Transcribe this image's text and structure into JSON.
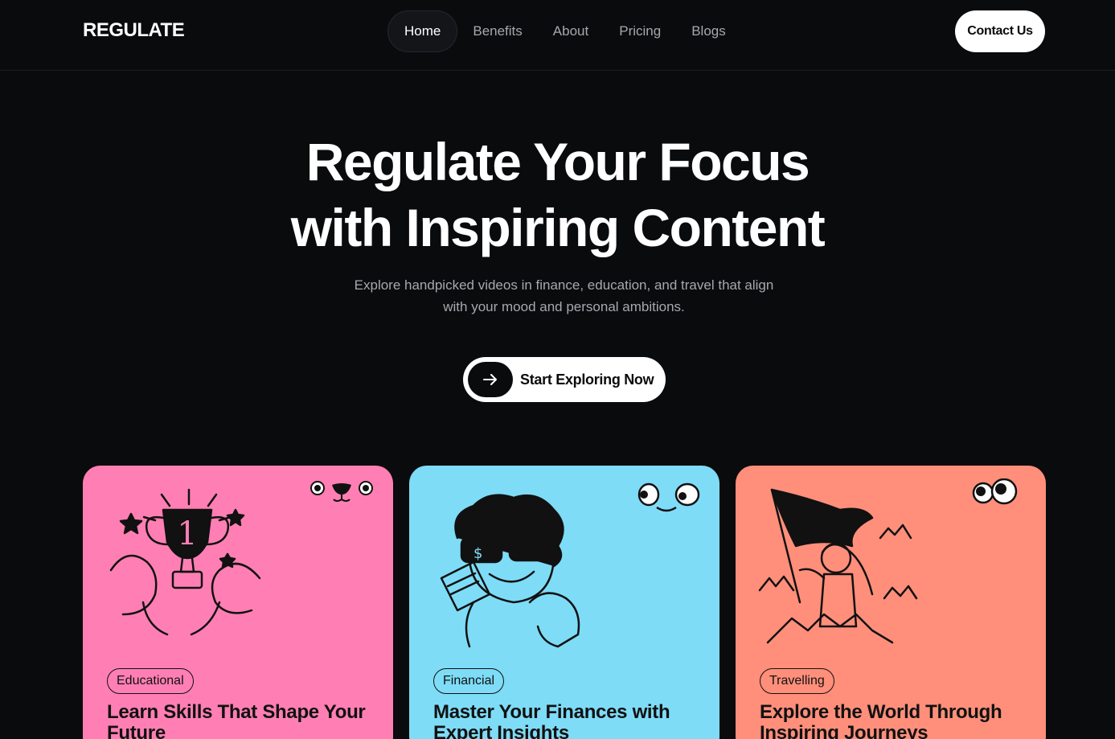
{
  "brand": "REGULATE",
  "nav": {
    "items": [
      {
        "label": "Home",
        "active": true
      },
      {
        "label": "Benefits",
        "active": false
      },
      {
        "label": "About",
        "active": false
      },
      {
        "label": "Pricing",
        "active": false
      },
      {
        "label": "Blogs",
        "active": false
      }
    ],
    "contact_label": "Contact Us"
  },
  "hero": {
    "title_line1": "Regulate Your Focus",
    "title_line2": "with Inspiring Content",
    "subtitle_line1": "Explore handpicked videos in finance, education, and travel that align",
    "subtitle_line2": "with your mood and personal ambitions.",
    "cta_label": "Start Exploring Now",
    "cta_icon": "arrow-right-icon"
  },
  "cards": [
    {
      "tag": "Educational",
      "title": "Learn Skills That Shape Your Future",
      "color": "#ff7fb4",
      "illustration": "trophy-icon"
    },
    {
      "tag": "Financial",
      "title": "Master Your Finances with Expert Insights",
      "color": "#7edcf7",
      "illustration": "money-character-icon"
    },
    {
      "tag": "Travelling",
      "title": "Explore the World Through Inspiring Journeys",
      "color": "#ff8f7a",
      "illustration": "flag-explorer-icon"
    }
  ],
  "colors": {
    "background": "#0a0b0d",
    "text": "#ffffff",
    "muted": "#a6a8ad"
  }
}
